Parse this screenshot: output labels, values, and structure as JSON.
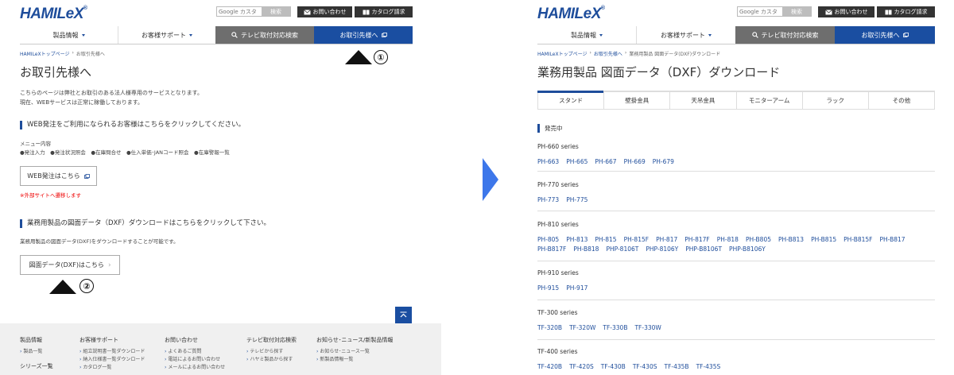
{
  "header": {
    "logo": "HAMILeX",
    "logo_mark": "®",
    "search_placeholder": "Google カスタ",
    "search_button": "検索",
    "contact": "お問い合わせ",
    "catalog": "カタログ請求"
  },
  "nav": {
    "products": "製品情報",
    "support": "お客様サポート",
    "tv_search": "テレビ取付対応検索",
    "partners": "お取引先様へ"
  },
  "left": {
    "breadcrumb": [
      "HAMILeXトップページ",
      "›",
      "お取引先様へ"
    ],
    "title": "お取引先様へ",
    "intro": [
      "こちらのページは弊社とお取引のある法人様専用のサービスとなります。",
      "現在、WEBサービスは正常に稼働しております。"
    ],
    "section1": {
      "heading": "WEB発注をご利用になられるお客様はこちらをクリックしてください。",
      "menu_label": "メニュー内容",
      "menu_items": "●発注入力　●発注状況照会　●在庫問合せ　●仕入単価･JANコード照会　●在庫警報一覧",
      "button": "WEB発注はこちら",
      "note": "※外部サイトへ遷移します"
    },
    "section2": {
      "heading": "業務用製品の図面データ（DXF）ダウンロードはこちらをクリックして下さい。",
      "desc": "業務用製品の図面データ(DXF)をダウンロードすることが可能です。",
      "button": "図面データ(DXF)はこちら"
    },
    "markers": [
      "①",
      "②"
    ],
    "footer": [
      {
        "head": "製品情報",
        "items": [
          "製品一覧"
        ],
        "extra": "シリーズ一覧"
      },
      {
        "head": "お客様サポート",
        "items": [
          "組立説明書一覧ダウンロード",
          "納入仕様書一覧ダウンロード",
          "カタログ一覧"
        ]
      },
      {
        "head": "お問い合わせ",
        "items": [
          "よくあるご質問",
          "電話によるお問い合わせ",
          "メールによるお問い合わせ"
        ]
      },
      {
        "head": "テレビ取付対応検索",
        "items": [
          "テレビから探す",
          "ハヤミ製品から探す"
        ]
      },
      {
        "head": "お知らせ･ニュース/新製品情報",
        "items": [
          "お知らせ･ニュース一覧",
          "新製品情報一覧"
        ]
      }
    ]
  },
  "right": {
    "breadcrumb": [
      "HAMILeXトップページ",
      "›",
      "お取引先様へ",
      "›",
      "業務用製品 図面データ(DXF)ダウンロード"
    ],
    "title": "業務用製品 図面データ（DXF）ダウンロード",
    "tabs": [
      "スタンド",
      "壁掛金具",
      "天吊金具",
      "モニターアーム",
      "ラック",
      "その他"
    ],
    "status_heading": "発売中",
    "series": [
      {
        "name": "PH-660 series",
        "items": [
          "PH-663",
          "PH-665",
          "PH-667",
          "PH-669",
          "PH-679"
        ]
      },
      {
        "name": "PH-770 series",
        "items": [
          "PH-773",
          "PH-775"
        ]
      },
      {
        "name": "PH-810 series",
        "items": [
          "PH-805",
          "PH-813",
          "PH-815",
          "PH-815F",
          "PH-817",
          "PH-817F",
          "PH-818",
          "PH-B805",
          "PH-B813",
          "PH-B815",
          "PH-B815F",
          "PH-B817",
          "PH-B817F",
          "PH-B818",
          "PHP-8106T",
          "PHP-8106Y",
          "PHP-B8106T",
          "PHP-B8106Y"
        ]
      },
      {
        "name": "PH-910 series",
        "items": [
          "PH-915",
          "PH-917"
        ]
      },
      {
        "name": "TF-300 series",
        "items": [
          "TF-320B",
          "TF-320W",
          "TF-330B",
          "TF-330W"
        ]
      },
      {
        "name": "TF-400 series",
        "items": [
          "TF-420B",
          "TF-420S",
          "TF-430B",
          "TF-430S",
          "TF-435B",
          "TF-435S"
        ]
      }
    ]
  },
  "colors": {
    "brand": "#1e4d9b",
    "nav_gray": "#6e6e6e",
    "arrow": "#3d77ea",
    "note": "#e00000"
  }
}
